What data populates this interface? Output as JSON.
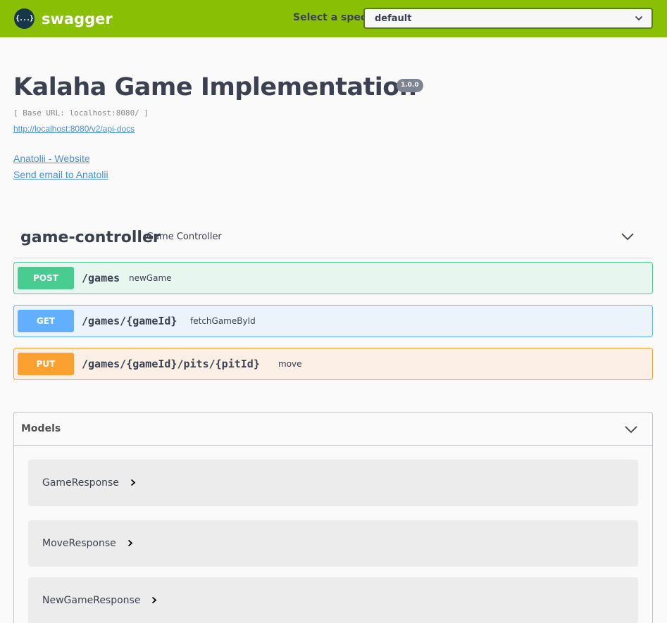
{
  "topbar": {
    "logo_icon": "{...}",
    "logo_text": "swagger",
    "spec_label": "Select a spec",
    "spec_selected": "default",
    "background": "#89bf04"
  },
  "info": {
    "title": "Kalaha Game Implementation",
    "version": "1.0.0",
    "base_url": "[ Base URL: localhost:8080/ ]",
    "docs_link": "http://localhost:8080/v2/api-docs",
    "contact_website": "Anatolii - Website",
    "contact_email": "Send email to Anatolii"
  },
  "tag": {
    "name": "game-controller",
    "description": "Game Controller"
  },
  "operations": [
    {
      "method": "POST",
      "path": "/games",
      "summary": "newGame",
      "color": "#49cc90"
    },
    {
      "method": "GET",
      "path": "/games/{gameId}",
      "summary": "fetchGameById",
      "color": "#61affe"
    },
    {
      "method": "PUT",
      "path": "/games/{gameId}/pits/{pitId}",
      "summary": "move",
      "color": "#fca130"
    }
  ],
  "models": {
    "title": "Models",
    "items": [
      "GameResponse",
      "MoveResponse",
      "NewGameResponse"
    ]
  },
  "icons": [
    "swagger-logo-icon",
    "chevron-down-icon",
    "chevron-right-icon"
  ]
}
